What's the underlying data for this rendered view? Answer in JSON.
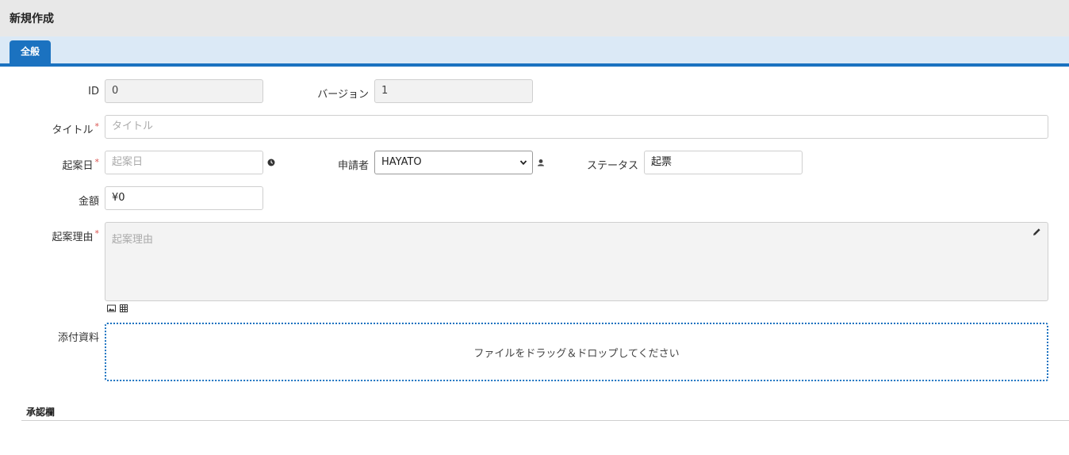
{
  "header": {
    "title": "新規作成"
  },
  "tabs": [
    {
      "label": "全般"
    }
  ],
  "form": {
    "id": {
      "label": "ID",
      "value": "0"
    },
    "version": {
      "label": "バージョン",
      "value": "1"
    },
    "title": {
      "label": "タイトル",
      "required_mark": "*",
      "placeholder": "タイトル"
    },
    "proposal_date": {
      "label": "起案日",
      "required_mark": "*",
      "placeholder": "起案日",
      "icon": "clock-icon"
    },
    "applicant": {
      "label": "申請者",
      "selected": "HAYATO",
      "icon": "user-icon"
    },
    "status": {
      "label": "ステータス",
      "value": "起票"
    },
    "amount": {
      "label": "金額",
      "value": "¥0"
    },
    "reason": {
      "label": "起案理由",
      "required_mark": "*",
      "placeholder": "起案理由",
      "icons": [
        "pencil-icon",
        "image-icon",
        "table-icon"
      ]
    },
    "attachments": {
      "label": "添付資料",
      "dropzone_text": "ファイルをドラッグ＆ドロップしてください"
    }
  },
  "approval_section": {
    "title": "承認欄"
  },
  "colors": {
    "accent": "#1b72c0",
    "header_bg": "#e8e8e8",
    "tabbar_bg": "#dbe9f6",
    "required": "#d9534f"
  }
}
